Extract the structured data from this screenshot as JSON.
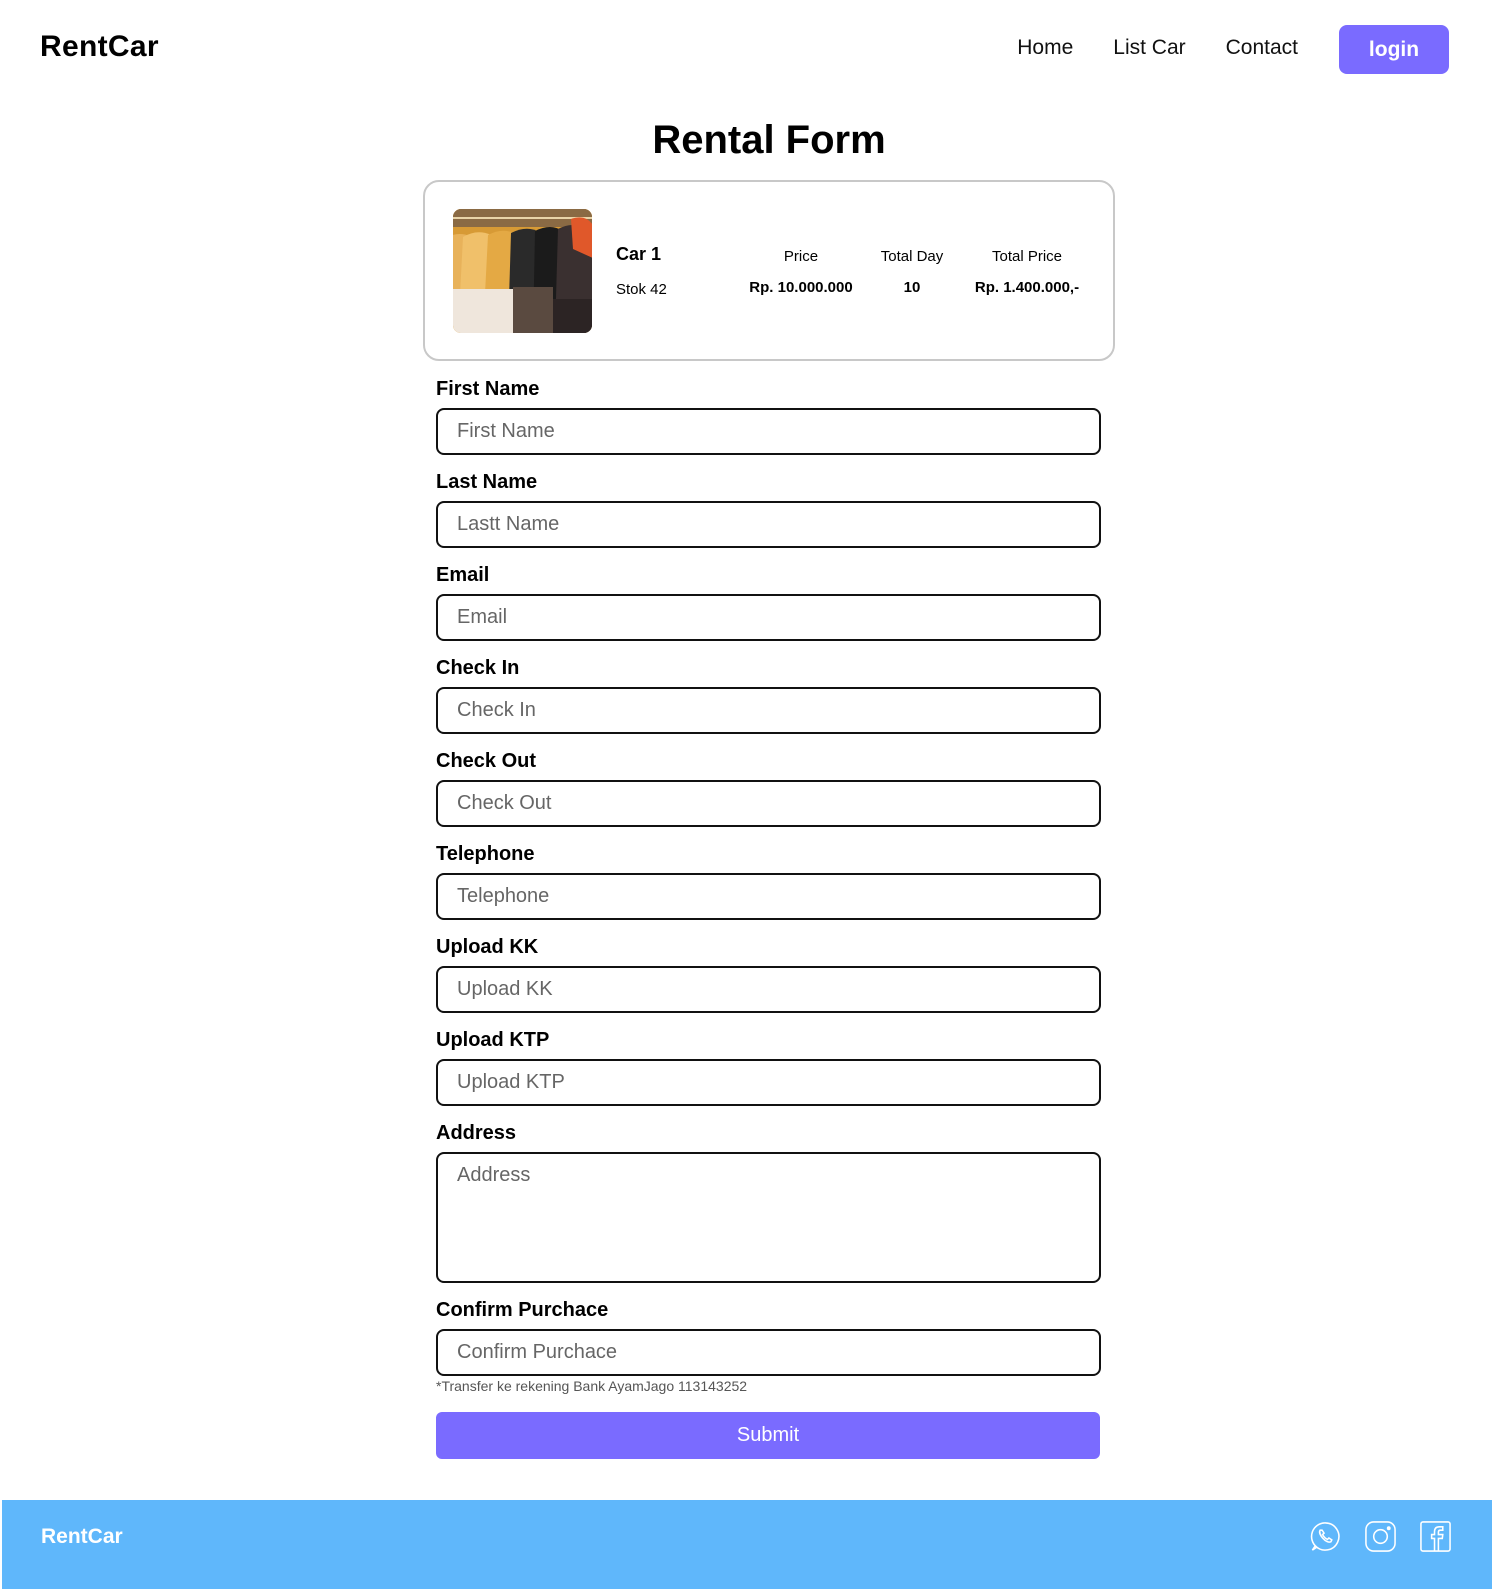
{
  "navbar": {
    "brand": "RentCar",
    "links": [
      "Home",
      "List Car",
      "Contact"
    ],
    "login_label": "login"
  },
  "page_title": "Rental Form",
  "car": {
    "name": "Car 1",
    "stock": "Stok 42",
    "price_label": "Price",
    "price_value": "Rp. 10.000.000",
    "total_day_label": "Total Day",
    "total_day_value": "10",
    "total_price_label": "Total Price",
    "total_price_value": "Rp. 1.400.000,-"
  },
  "form": {
    "first_name": {
      "label": "First Name",
      "placeholder": "First Name"
    },
    "last_name": {
      "label": "Last Name",
      "placeholder": "Lastt Name"
    },
    "email": {
      "label": "Email",
      "placeholder": "Email"
    },
    "check_in": {
      "label": "Check In",
      "placeholder": "Check In"
    },
    "check_out": {
      "label": "Check Out",
      "placeholder": "Check Out"
    },
    "telephone": {
      "label": "Telephone",
      "placeholder": "Telephone"
    },
    "upload_kk": {
      "label": "Upload KK",
      "placeholder": "Upload KK"
    },
    "upload_ktp": {
      "label": "Upload KTP",
      "placeholder": "Upload KTP"
    },
    "address": {
      "label": "Address",
      "placeholder": "Address"
    },
    "confirm_purchase": {
      "label": "Confirm Purchace",
      "placeholder": "Confirm Purchace"
    },
    "note": "*Transfer ke rekening Bank AyamJago 113143252",
    "submit_label": "Submit"
  },
  "footer": {
    "brand": "RentCar",
    "icons": [
      "whatsapp-icon",
      "instagram-icon",
      "facebook-icon"
    ]
  },
  "colors": {
    "accent": "#7a6bff",
    "footer_bg": "#5fb7fb"
  }
}
